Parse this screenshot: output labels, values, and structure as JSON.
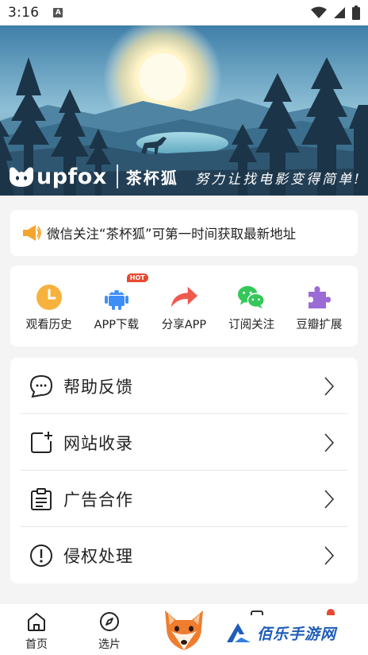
{
  "status_bar": {
    "time": "3:16",
    "notification_glyph": "A"
  },
  "banner": {
    "brand_logo_text": "upfox",
    "brand_name": "茶杯狐",
    "slogan": "努力让找电影变得简单!"
  },
  "notice": {
    "text": "微信关注“茶杯狐”可第一时间获取最新地址"
  },
  "quick_actions": [
    {
      "label": "观看历史",
      "icon": "clock-icon"
    },
    {
      "label": "APP下载",
      "icon": "android-icon",
      "badge": "HOT"
    },
    {
      "label": "分享APP",
      "icon": "share-arrow-icon"
    },
    {
      "label": "订阅关注",
      "icon": "wechat-icon"
    },
    {
      "label": "豆瓣扩展",
      "icon": "puzzle-icon"
    }
  ],
  "menu": [
    {
      "label": "帮助反馈",
      "icon": "chat-bubble-icon"
    },
    {
      "label": "网站收录",
      "icon": "add-square-icon"
    },
    {
      "label": "广告合作",
      "icon": "clipboard-icon"
    },
    {
      "label": "侵权处理",
      "icon": "alert-circle-icon"
    }
  ],
  "bottom_nav": {
    "home": "首页",
    "discover": "选片",
    "watermark": "佰乐手游网"
  },
  "colors": {
    "accent_orange": "#f4a52f",
    "hot_red": "#e8492f",
    "android_blue": "#3e8ef7",
    "share_red": "#f05a4d",
    "wechat_green": "#34c759",
    "puzzle_purple": "#9b6bd6",
    "watermark_blue": "#1e5db8"
  }
}
